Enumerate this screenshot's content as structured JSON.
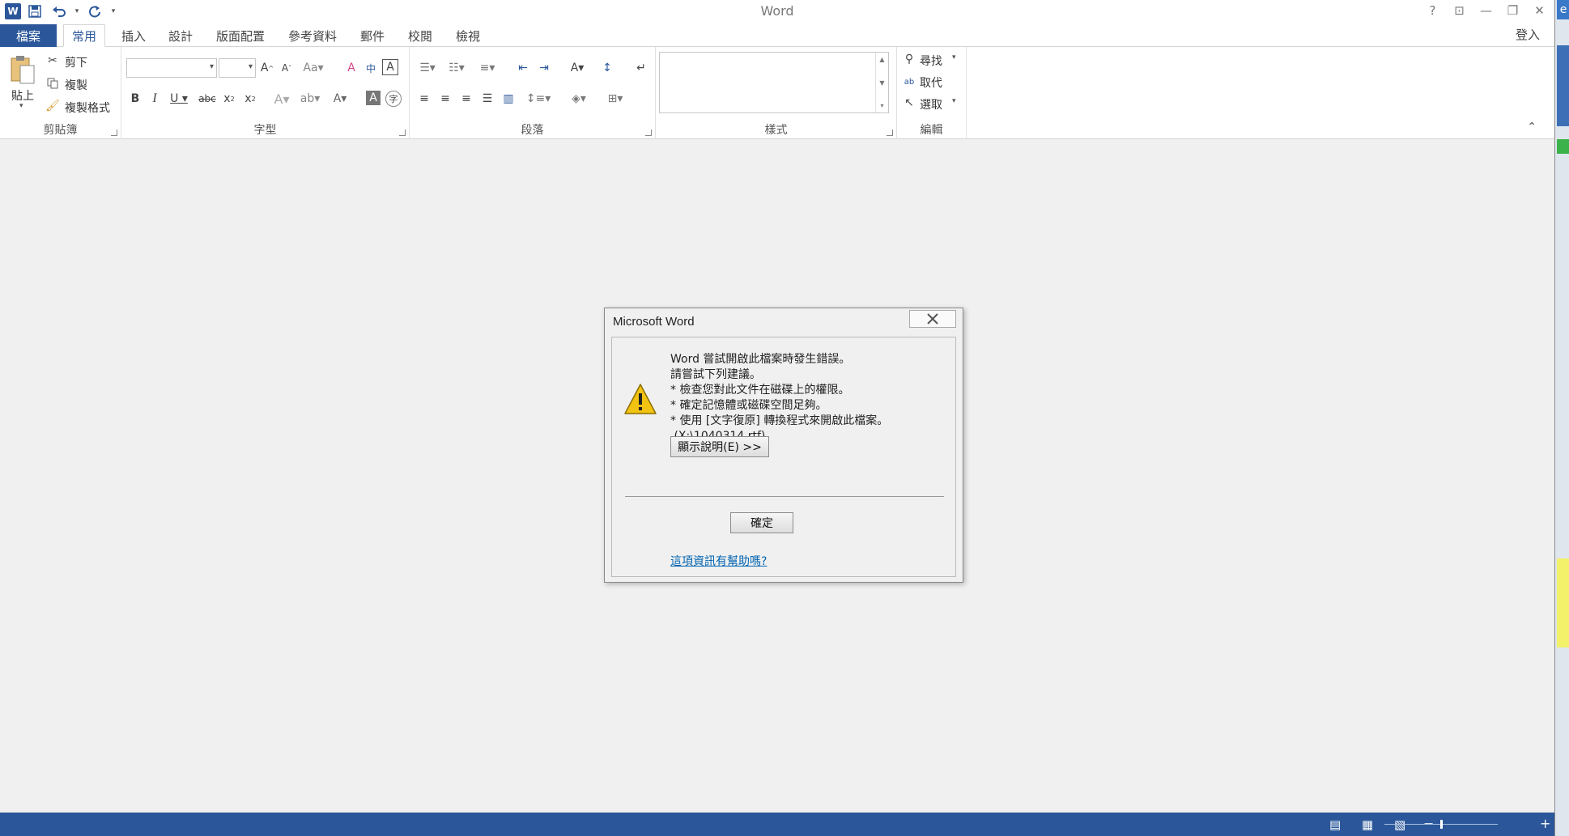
{
  "app_title": "Word",
  "qat": {
    "logo": "W",
    "save_icon": "floppy-icon",
    "undo_icon": "undo-icon",
    "redo_icon": "redo-icon"
  },
  "window_controls": {
    "help": "?",
    "ribbon_display": "⊡",
    "minimize": "—",
    "restore": "❐",
    "close": "✕"
  },
  "tabs": [
    "檔案",
    "常用",
    "插入",
    "設計",
    "版面配置",
    "參考資料",
    "郵件",
    "校閱",
    "檢視"
  ],
  "active_tab": "常用",
  "sign_in": "登入",
  "ribbon": {
    "clipboard": {
      "label": "剪貼簿",
      "paste": "貼上",
      "cut": "剪下",
      "copy": "複製",
      "format_painter": "複製格式"
    },
    "font": {
      "label": "字型",
      "font_name": "",
      "font_size": ""
    },
    "paragraph": {
      "label": "段落"
    },
    "styles": {
      "label": "樣式"
    },
    "editing": {
      "label": "編輯",
      "find": "尋找",
      "replace": "取代",
      "select": "選取"
    }
  },
  "dialog": {
    "title": "Microsoft Word",
    "message_lines": [
      "Word 嘗試開啟此檔案時發生錯誤。",
      "請嘗試下列建議。",
      "* 檢查您對此文件在磁碟上的權限。",
      "* 確定記憶體或磁碟空間足夠。",
      "* 使用 [文字復原] 轉換程式來開啟此檔案。",
      " (X:\\1040314.rtf)"
    ],
    "show_help_button": "顯示說明(E) >>",
    "ok_button": "確定",
    "feedback_link": "這項資訊有幫助嗎?"
  },
  "colors": {
    "accent": "#2b579a",
    "link": "#0063b1",
    "warning": "#f2c311"
  }
}
